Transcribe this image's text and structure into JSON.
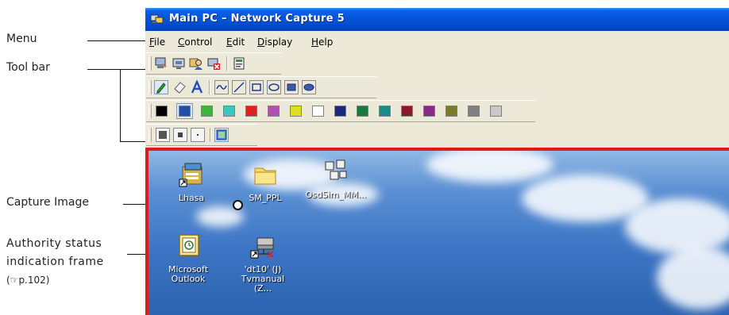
{
  "window": {
    "title": "Main PC  –  Network Capture 5",
    "menu": [
      {
        "label": "File",
        "ul": "F",
        "rest": "ile"
      },
      {
        "label": "Control",
        "ul": "C",
        "rest": "ontrol"
      },
      {
        "label": "Edit",
        "ul": "E",
        "rest": "dit"
      },
      {
        "label": "Display",
        "ul": "D",
        "rest": "isplay"
      },
      {
        "label": "Help",
        "ul": "H",
        "rest": "elp"
      }
    ]
  },
  "callouts": {
    "menu": "Menu",
    "toolbar": "Tool bar",
    "capture": "Capture Image",
    "authority_line1": "Authority status",
    "authority_line2": "indication frame",
    "authority_ref": "(☞p.102)"
  },
  "toolbar": {
    "row1_icons": [
      "connect-icon",
      "monitor-icon",
      "user-icon",
      "disconnect-icon",
      "properties-icon"
    ],
    "row2_icons": [
      "pen-icon",
      "eraser-icon",
      "text-icon",
      "freehand-icon",
      "line-icon",
      "rectangle-icon",
      "ellipse-icon",
      "filled-rectangle-icon",
      "filled-ellipse-icon"
    ],
    "colors": [
      "#000000",
      "#1f4fa8",
      "#3fb53f",
      "#3fc4c4",
      "#e02020",
      "#b050b0",
      "#e0e020",
      "#ffffff",
      "#1a2a7a",
      "#1a7a3a",
      "#1a8a8a",
      "#8a1a2a",
      "#8a2a8a",
      "#7a7a2a",
      "#808080",
      "#c8c8c8"
    ],
    "selected_color_index": 1,
    "row4_icons": [
      "thick-line-icon",
      "medium-line-icon",
      "thin-line-icon",
      "frame-icon"
    ]
  },
  "desktop_icons": [
    {
      "label": "Lhasa"
    },
    {
      "label": "SM_PPL"
    },
    {
      "label": "OsdSim_MM..."
    },
    {
      "label1": "Microsoft",
      "label2": "Outlook"
    },
    {
      "label1": "'dt10' (J)",
      "label2": "Tvmanual (Z..."
    }
  ],
  "colors": {
    "authority_frame": "#e11919",
    "titlebar": "#0554d8"
  }
}
